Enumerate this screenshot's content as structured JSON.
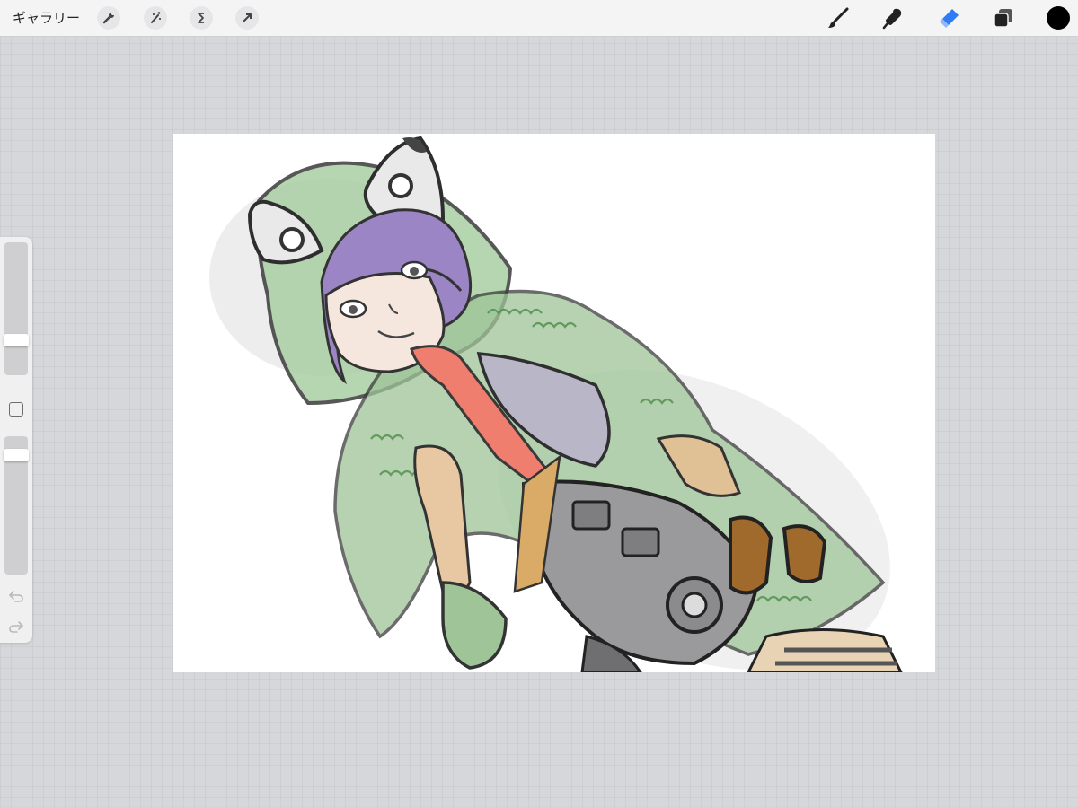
{
  "toolbar": {
    "gallery_label": "ギャラリー",
    "left_tools": [
      "wrench-icon",
      "magic-wand-icon",
      "selection-s-icon",
      "transform-arrow-icon"
    ],
    "right_tools": [
      "brush-icon",
      "smudge-icon",
      "eraser-icon",
      "layers-icon"
    ],
    "active_tool": "eraser-icon",
    "active_color": "#000000",
    "accent_color": "#2f7cf6"
  },
  "sidebar": {
    "brush_size": 0.24,
    "opacity": 0.9,
    "modifier_icon": "square-modifier-icon",
    "undo_icon": "undo-icon",
    "redo_icon": "redo-icon"
  },
  "canvas": {
    "background": "#ffffff",
    "artwork": "drawing-of-girl-in-green-fox-hood"
  }
}
